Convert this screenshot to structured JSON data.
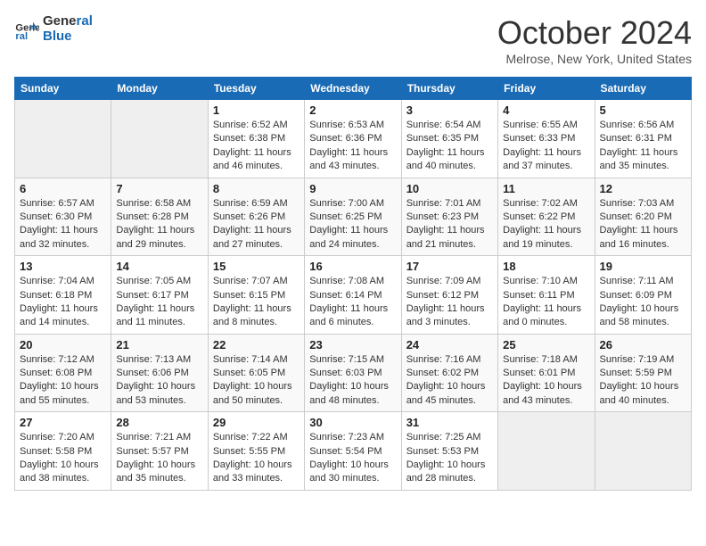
{
  "header": {
    "logo_line1": "General",
    "logo_line2": "Blue",
    "month": "October 2024",
    "location": "Melrose, New York, United States"
  },
  "days_of_week": [
    "Sunday",
    "Monday",
    "Tuesday",
    "Wednesday",
    "Thursday",
    "Friday",
    "Saturday"
  ],
  "weeks": [
    [
      {
        "day": "",
        "info": ""
      },
      {
        "day": "",
        "info": ""
      },
      {
        "day": "1",
        "info": "Sunrise: 6:52 AM\nSunset: 6:38 PM\nDaylight: 11 hours and 46 minutes."
      },
      {
        "day": "2",
        "info": "Sunrise: 6:53 AM\nSunset: 6:36 PM\nDaylight: 11 hours and 43 minutes."
      },
      {
        "day": "3",
        "info": "Sunrise: 6:54 AM\nSunset: 6:35 PM\nDaylight: 11 hours and 40 minutes."
      },
      {
        "day": "4",
        "info": "Sunrise: 6:55 AM\nSunset: 6:33 PM\nDaylight: 11 hours and 37 minutes."
      },
      {
        "day": "5",
        "info": "Sunrise: 6:56 AM\nSunset: 6:31 PM\nDaylight: 11 hours and 35 minutes."
      }
    ],
    [
      {
        "day": "6",
        "info": "Sunrise: 6:57 AM\nSunset: 6:30 PM\nDaylight: 11 hours and 32 minutes."
      },
      {
        "day": "7",
        "info": "Sunrise: 6:58 AM\nSunset: 6:28 PM\nDaylight: 11 hours and 29 minutes."
      },
      {
        "day": "8",
        "info": "Sunrise: 6:59 AM\nSunset: 6:26 PM\nDaylight: 11 hours and 27 minutes."
      },
      {
        "day": "9",
        "info": "Sunrise: 7:00 AM\nSunset: 6:25 PM\nDaylight: 11 hours and 24 minutes."
      },
      {
        "day": "10",
        "info": "Sunrise: 7:01 AM\nSunset: 6:23 PM\nDaylight: 11 hours and 21 minutes."
      },
      {
        "day": "11",
        "info": "Sunrise: 7:02 AM\nSunset: 6:22 PM\nDaylight: 11 hours and 19 minutes."
      },
      {
        "day": "12",
        "info": "Sunrise: 7:03 AM\nSunset: 6:20 PM\nDaylight: 11 hours and 16 minutes."
      }
    ],
    [
      {
        "day": "13",
        "info": "Sunrise: 7:04 AM\nSunset: 6:18 PM\nDaylight: 11 hours and 14 minutes."
      },
      {
        "day": "14",
        "info": "Sunrise: 7:05 AM\nSunset: 6:17 PM\nDaylight: 11 hours and 11 minutes."
      },
      {
        "day": "15",
        "info": "Sunrise: 7:07 AM\nSunset: 6:15 PM\nDaylight: 11 hours and 8 minutes."
      },
      {
        "day": "16",
        "info": "Sunrise: 7:08 AM\nSunset: 6:14 PM\nDaylight: 11 hours and 6 minutes."
      },
      {
        "day": "17",
        "info": "Sunrise: 7:09 AM\nSunset: 6:12 PM\nDaylight: 11 hours and 3 minutes."
      },
      {
        "day": "18",
        "info": "Sunrise: 7:10 AM\nSunset: 6:11 PM\nDaylight: 11 hours and 0 minutes."
      },
      {
        "day": "19",
        "info": "Sunrise: 7:11 AM\nSunset: 6:09 PM\nDaylight: 10 hours and 58 minutes."
      }
    ],
    [
      {
        "day": "20",
        "info": "Sunrise: 7:12 AM\nSunset: 6:08 PM\nDaylight: 10 hours and 55 minutes."
      },
      {
        "day": "21",
        "info": "Sunrise: 7:13 AM\nSunset: 6:06 PM\nDaylight: 10 hours and 53 minutes."
      },
      {
        "day": "22",
        "info": "Sunrise: 7:14 AM\nSunset: 6:05 PM\nDaylight: 10 hours and 50 minutes."
      },
      {
        "day": "23",
        "info": "Sunrise: 7:15 AM\nSunset: 6:03 PM\nDaylight: 10 hours and 48 minutes."
      },
      {
        "day": "24",
        "info": "Sunrise: 7:16 AM\nSunset: 6:02 PM\nDaylight: 10 hours and 45 minutes."
      },
      {
        "day": "25",
        "info": "Sunrise: 7:18 AM\nSunset: 6:01 PM\nDaylight: 10 hours and 43 minutes."
      },
      {
        "day": "26",
        "info": "Sunrise: 7:19 AM\nSunset: 5:59 PM\nDaylight: 10 hours and 40 minutes."
      }
    ],
    [
      {
        "day": "27",
        "info": "Sunrise: 7:20 AM\nSunset: 5:58 PM\nDaylight: 10 hours and 38 minutes."
      },
      {
        "day": "28",
        "info": "Sunrise: 7:21 AM\nSunset: 5:57 PM\nDaylight: 10 hours and 35 minutes."
      },
      {
        "day": "29",
        "info": "Sunrise: 7:22 AM\nSunset: 5:55 PM\nDaylight: 10 hours and 33 minutes."
      },
      {
        "day": "30",
        "info": "Sunrise: 7:23 AM\nSunset: 5:54 PM\nDaylight: 10 hours and 30 minutes."
      },
      {
        "day": "31",
        "info": "Sunrise: 7:25 AM\nSunset: 5:53 PM\nDaylight: 10 hours and 28 minutes."
      },
      {
        "day": "",
        "info": ""
      },
      {
        "day": "",
        "info": ""
      }
    ]
  ]
}
